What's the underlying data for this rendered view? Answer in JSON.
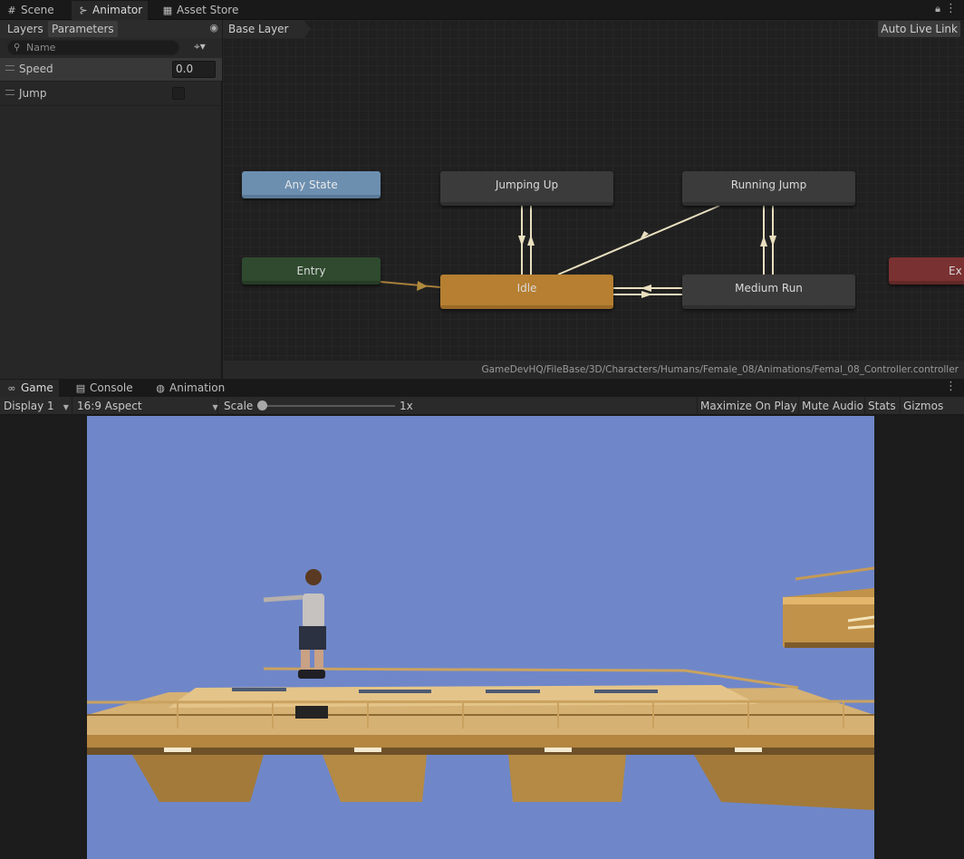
{
  "top_tabs": [
    {
      "label": "Scene",
      "icon": "grid-icon"
    },
    {
      "label": "Animator",
      "icon": "animator-icon"
    },
    {
      "label": "Asset Store",
      "icon": "store-icon"
    }
  ],
  "left_panel": {
    "tabs": [
      "Layers",
      "Parameters"
    ],
    "search_placeholder": "Name",
    "parameters": [
      {
        "name": "Speed",
        "value": "0.0",
        "type": "float"
      },
      {
        "name": "Jump",
        "value": "",
        "type": "bool"
      }
    ]
  },
  "graph": {
    "breadcrumb": "Base Layer",
    "auto_live_link": "Auto Live Link",
    "asset_path": "GameDevHQ/FileBase/3D/Characters/Humans/Female_08/Animations/Femal_08_Controller.controller",
    "states": {
      "any_state": "Any State",
      "entry": "Entry",
      "jumping_up": "Jumping Up",
      "running_jump": "Running Jump",
      "idle": "Idle",
      "medium_run": "Medium Run",
      "exit": "Ex"
    }
  },
  "bottom_tabs": [
    {
      "label": "Game",
      "icon": "gamepad-icon"
    },
    {
      "label": "Console",
      "icon": "console-icon"
    },
    {
      "label": "Animation",
      "icon": "animation-icon"
    }
  ],
  "game_toolbar": {
    "display": "Display 1",
    "aspect": "16:9 Aspect",
    "scale_label": "Scale",
    "scale_value": "1x",
    "maximize": "Maximize On Play",
    "mute": "Mute Audio",
    "stats": "Stats",
    "gizmos": "Gizmos"
  },
  "colors": {
    "sky": "#6f87c9",
    "idle_state": "#b67f31",
    "any_state": "#6c8fb0",
    "entry_state": "#2f4a2f",
    "exit_state": "#7a3131"
  }
}
